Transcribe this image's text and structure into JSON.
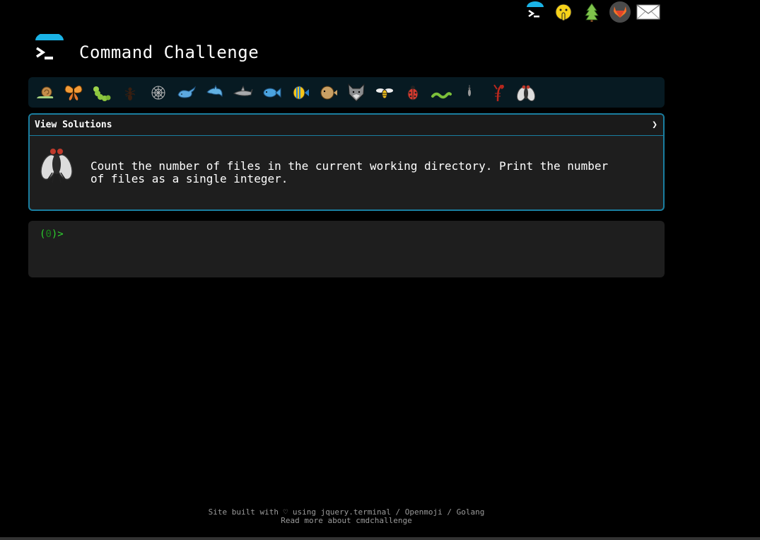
{
  "header": {
    "title": "Command Challenge"
  },
  "top_icons": [
    {
      "name": "terminal-logo-icon"
    },
    {
      "name": "shushing-face-icon"
    },
    {
      "name": "tree-icon"
    },
    {
      "name": "gitlab-icon"
    },
    {
      "name": "mail-icon"
    }
  ],
  "challenges": [
    {
      "name": "snail-icon"
    },
    {
      "name": "butterfly-icon"
    },
    {
      "name": "caterpillar-icon"
    },
    {
      "name": "ant-icon"
    },
    {
      "name": "spider-web-icon"
    },
    {
      "name": "whale-icon"
    },
    {
      "name": "dolphin-icon"
    },
    {
      "name": "shark-icon"
    },
    {
      "name": "fish-icon"
    },
    {
      "name": "tropical-fish-icon"
    },
    {
      "name": "blowfish-icon"
    },
    {
      "name": "wolf-icon"
    },
    {
      "name": "bee-icon"
    },
    {
      "name": "ladybug-icon"
    },
    {
      "name": "worm-icon"
    },
    {
      "name": "mosquito-icon"
    },
    {
      "name": "scorpion-icon"
    },
    {
      "name": "fly-icon"
    }
  ],
  "panel": {
    "header": "View Solutions",
    "chevron": "❯",
    "description": "Count the number of files in the current working directory. Print the number of files as a single integer."
  },
  "terminal": {
    "prompt_open": "(",
    "prompt_count": "0",
    "prompt_close": ")>"
  },
  "footer": {
    "line1": "Site built with ♡ using jquery.terminal / Openmoji / Golang",
    "line2": "Read more about cmdchallenge"
  },
  "colors": {
    "accent": "#1a7ea0",
    "prompt_green": "#2fd22f",
    "logo_blue": "#1ab3e6"
  }
}
